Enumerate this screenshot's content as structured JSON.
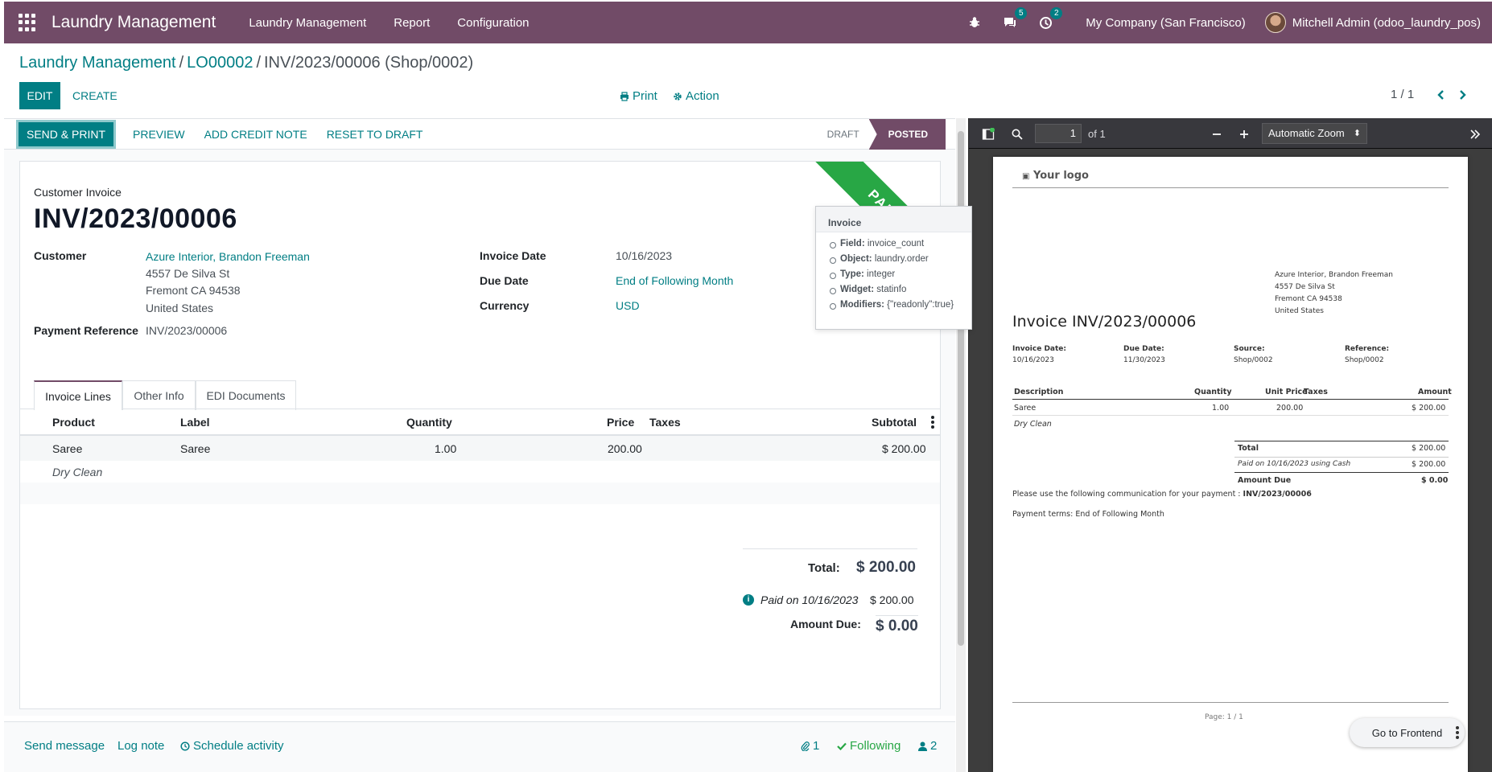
{
  "navbar": {
    "brand": "Laundry Management",
    "menus": [
      "Laundry Management",
      "Report",
      "Configuration"
    ],
    "messages_badge": "5",
    "activities_badge": "2",
    "company": "My Company (San Francisco)",
    "user": "Mitchell Admin (odoo_laundry_pos)",
    "color": "#714b67"
  },
  "breadcrumb": {
    "items": [
      "Laundry Management",
      "LO00002"
    ],
    "current": "INV/2023/00006 (Shop/0002)",
    "separator": "/"
  },
  "control": {
    "edit_label": "EDIT",
    "create_label": "CREATE",
    "print_label": "Print",
    "action_label": "Action",
    "pager": "1 / 1"
  },
  "statusbar": {
    "buttons": [
      "SEND & PRINT",
      "PREVIEW",
      "ADD CREDIT NOTE",
      "RESET TO DRAFT"
    ],
    "states": [
      "DRAFT",
      "POSTED"
    ],
    "active_state": "POSTED"
  },
  "invoice": {
    "ribbon": "PAID",
    "doc_type": "Customer Invoice",
    "name": "INV/2023/00006",
    "customer_label": "Customer",
    "customer_name": "Azure Interior, Brandon Freeman",
    "address": [
      "4557 De Silva St",
      "Fremont CA 94538",
      "United States"
    ],
    "payment_ref_label": "Payment Reference",
    "payment_ref": "INV/2023/00006",
    "invoice_date_label": "Invoice Date",
    "invoice_date": "10/16/2023",
    "due_date_label": "Due Date",
    "due_date": "End of Following Month",
    "currency_label": "Currency",
    "currency": "USD"
  },
  "tabs": [
    "Invoice Lines",
    "Other Info",
    "EDI Documents"
  ],
  "lines": {
    "columns": [
      "Product",
      "Label",
      "Quantity",
      "Price",
      "Taxes",
      "Subtotal"
    ],
    "rows": [
      {
        "product": "Saree",
        "label": "Saree",
        "quantity": "1.00",
        "price": "200.00",
        "taxes": "",
        "subtotal": "$ 200.00"
      }
    ],
    "note": "Dry Clean"
  },
  "totals": {
    "total_label": "Total:",
    "total": "$ 200.00",
    "paid_label": "Paid on 10/16/2023",
    "paid": "$ 200.00",
    "due_label": "Amount Due:",
    "due": "$ 0.00"
  },
  "tooltip": {
    "title": "Invoice",
    "items": [
      {
        "key": "Field:",
        "value": "invoice_count"
      },
      {
        "key": "Object:",
        "value": "laundry.order"
      },
      {
        "key": "Type:",
        "value": "integer"
      },
      {
        "key": "Widget:",
        "value": "statinfo"
      },
      {
        "key": "Modifiers:",
        "value": "{\"readonly\":true}"
      }
    ]
  },
  "chatter": {
    "send_message": "Send message",
    "log_note": "Log note",
    "schedule_activity": "Schedule activity",
    "attachments": "1",
    "following": "Following",
    "followers": "2"
  },
  "pdf": {
    "page_input": "1",
    "page_of": "of 1",
    "zoom": "Automatic Zoom",
    "logo": "Your logo",
    "address": [
      "Azure Interior, Brandon Freeman",
      "4557 De Silva St",
      "Fremont CA 94538",
      "United States"
    ],
    "title": "Invoice INV/2023/00006",
    "meta": [
      {
        "label": "Invoice Date:",
        "value": "10/16/2023"
      },
      {
        "label": "Due Date:",
        "value": "11/30/2023"
      },
      {
        "label": "Source:",
        "value": "Shop/0002"
      },
      {
        "label": "Reference:",
        "value": "Shop/0002"
      }
    ],
    "columns": [
      "Description",
      "Quantity",
      "Unit Price",
      "Taxes",
      "Amount"
    ],
    "row": {
      "description": "Saree",
      "quantity": "1.00",
      "unit_price": "200.00",
      "amount": "$ 200.00"
    },
    "note": "Dry Clean",
    "total_label": "Total",
    "total": "$ 200.00",
    "paid_label": "Paid on 10/16/2023 using Cash",
    "paid": "$ 200.00",
    "due_label": "Amount Due",
    "due": "$ 0.00",
    "communication_text": "Please use the following communication for your payment :",
    "communication_ref": "INV/2023/00006",
    "payment_terms": "Payment terms: End of Following Month",
    "footer": "Page: 1 / 1",
    "go_frontend": "Go to Frontend"
  }
}
